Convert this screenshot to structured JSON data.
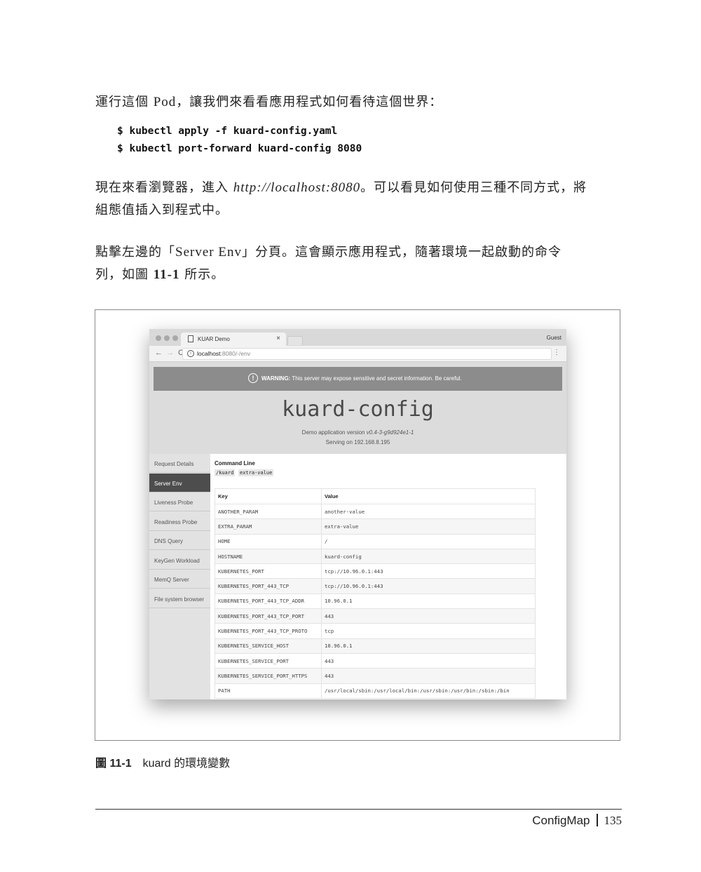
{
  "paragraphs": {
    "p1": {
      "a": "運行這個 ",
      "pod": "Pod",
      "b": "，讓我們來看看應用程式如何看待這個世界："
    },
    "p2": {
      "a": "現在來看瀏覽器，進入 ",
      "url": "http://localhost:8080",
      "b": "。可以看見如何使用三種不同方式，將",
      "c": "組態值插入到程式中。"
    },
    "p3": {
      "a": "點擊左邊的「",
      "tab": "Server Env",
      "b": "」分頁。這會顯示應用程式，隨著環境一起啟動的命令",
      "c": "列，如圖 ",
      "fig": "11-1",
      "d": " 所示。"
    }
  },
  "code": {
    "line1": "$ kubectl apply -f kuard-config.yaml",
    "line2": "$ kubectl port-forward kuard-config 8080"
  },
  "browser": {
    "tab_title": "KUAR Demo",
    "tab_close": "×",
    "guest_label": "Guest",
    "nav_back": "←",
    "nav_forward": "→",
    "nav_reload": "C",
    "url_host": "localhost",
    "url_rest": ":8080/-/env",
    "menu": "⋮"
  },
  "app": {
    "warning_label": "WARNING:",
    "warning_text": " This server may expose sensitive and secret information. Be careful.",
    "title": "kuard-config",
    "version_prefix": "Demo application version ",
    "version": "v0.4-3-g9d924e1-1",
    "serving": "Serving on 192.168.8.195",
    "sidebar": [
      "Request Details",
      "Server Env",
      "Liveness Probe",
      "Readiness Probe",
      "DNS Query",
      "KeyGen Workload",
      "MemQ Server",
      "File system browser"
    ],
    "active_tab": "Server Env",
    "command_line_label": "Command Line",
    "command_args": [
      "/kuard",
      "extra-value"
    ],
    "table_headers": [
      "Key",
      "Value"
    ],
    "env": [
      [
        "ANOTHER_PARAM",
        "another-value"
      ],
      [
        "EXTRA_PARAM",
        "extra-value"
      ],
      [
        "HOME",
        "/"
      ],
      [
        "HOSTNAME",
        "kuard-config"
      ],
      [
        "KUBERNETES_PORT",
        "tcp://10.96.0.1:443"
      ],
      [
        "KUBERNETES_PORT_443_TCP",
        "tcp://10.96.0.1:443"
      ],
      [
        "KUBERNETES_PORT_443_TCP_ADDR",
        "10.96.0.1"
      ],
      [
        "KUBERNETES_PORT_443_TCP_PORT",
        "443"
      ],
      [
        "KUBERNETES_PORT_443_TCP_PROTO",
        "tcp"
      ],
      [
        "KUBERNETES_SERVICE_HOST",
        "10.96.0.1"
      ],
      [
        "KUBERNETES_SERVICE_PORT",
        "443"
      ],
      [
        "KUBERNETES_SERVICE_PORT_HTTPS",
        "443"
      ],
      [
        "PATH",
        "/usr/local/sbin:/usr/local/bin:/usr/sbin:/usr/bin:/sbin:/bin"
      ]
    ]
  },
  "caption": {
    "fig_no": "圖 11-1",
    "text": "kuard 的環境變數"
  },
  "footer": {
    "chapter": "ConfigMap",
    "page": "135"
  }
}
